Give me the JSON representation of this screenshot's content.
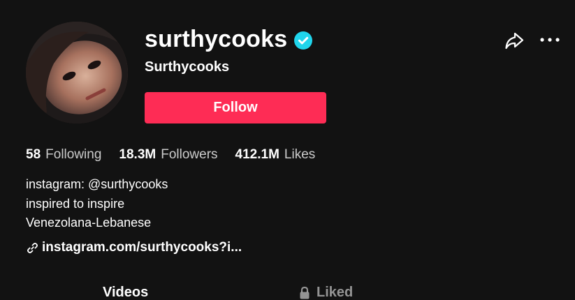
{
  "profile": {
    "username": "surthycooks",
    "nickname": "Surthycooks",
    "verified": true,
    "follow_label": "Follow"
  },
  "stats": {
    "following_count": "58",
    "following_label": "Following",
    "followers_count": "18.3M",
    "followers_label": "Followers",
    "likes_count": "412.1M",
    "likes_label": "Likes"
  },
  "bio": {
    "lines": [
      "instagram: @surthycooks",
      "inspired to inspire",
      "Venezolana-Lebanese"
    ]
  },
  "link": {
    "text": "instagram.com/surthycooks?i..."
  },
  "tabs": [
    {
      "label": "Videos"
    },
    {
      "label": "Liked"
    }
  ],
  "icons": {
    "verified": "verified-badge-icon",
    "share": "share-arrow-icon",
    "more": "more-dots-icon",
    "link": "link-chain-icon",
    "lock": "lock-icon"
  },
  "colors": {
    "background": "#121212",
    "accent": "#fe2c55",
    "verified": "#20d5ec",
    "text": "#ffffff"
  }
}
